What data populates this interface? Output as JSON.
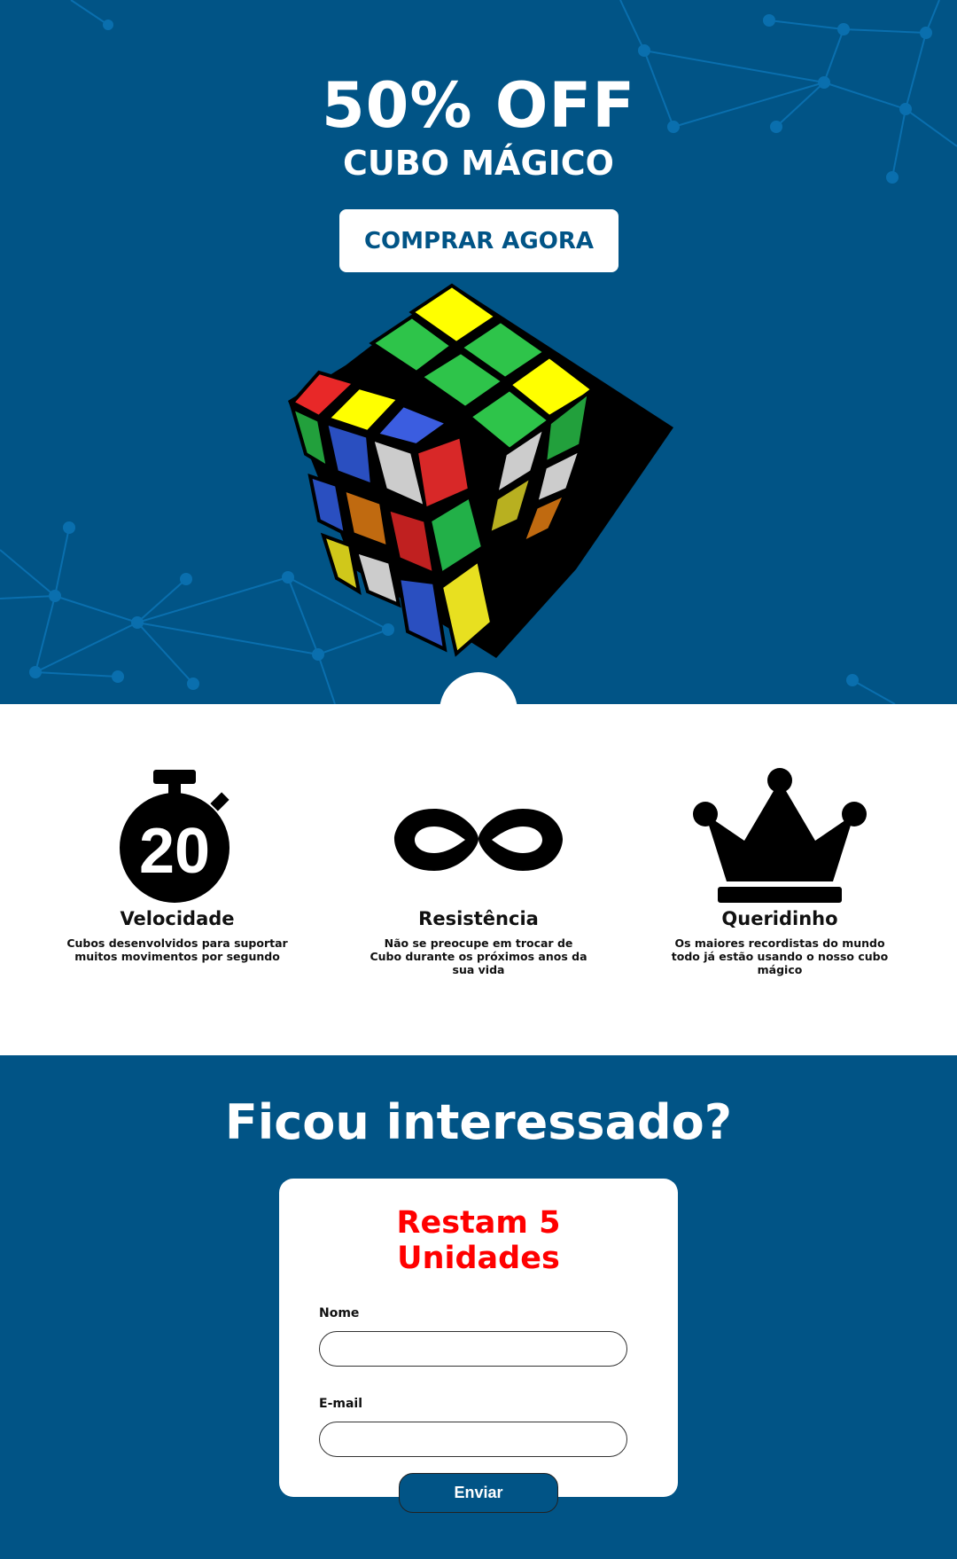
{
  "hero": {
    "title": "50% OFF",
    "subtitle": "CUBO MÁGICO",
    "buy_label": "COMPRAR AGORA"
  },
  "features": [
    {
      "icon": "stopwatch-20-icon",
      "timer_number": "20",
      "title": "Velocidade",
      "desc": "Cubos desenvolvidos para suportar muitos movimentos por segundo"
    },
    {
      "icon": "infinity-icon",
      "title": "Resistência",
      "desc": "Não se preocupe em trocar de Cubo durante os próximos anos da sua vida"
    },
    {
      "icon": "crown-icon",
      "title": "Queridinho",
      "desc": "Os maiores recordistas do mundo todo já estão usando o nosso cubo mágico"
    }
  ],
  "cta": {
    "heading": "Ficou interessado?",
    "stock": "Restam 5 Unidades",
    "name_label": "Nome",
    "email_label": "E-mail",
    "submit_label": "Enviar"
  },
  "colors": {
    "brand": "#015486",
    "alert": "#ff0000"
  }
}
